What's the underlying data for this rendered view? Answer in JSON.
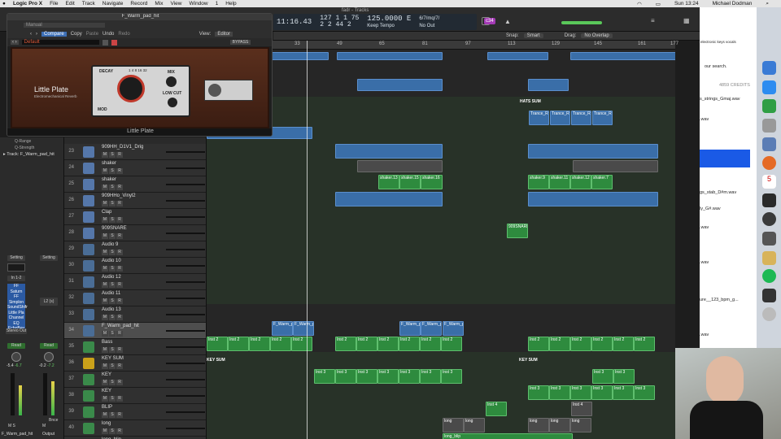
{
  "menubar": {
    "app": "Logic Pro X",
    "items": [
      "File",
      "Edit",
      "Track",
      "Navigate",
      "Record",
      "Mix",
      "View",
      "Window",
      "1",
      "Help"
    ],
    "clock": "Sun 13:24",
    "user": "Michael Dodman"
  },
  "window_title": "fadr - Tracks",
  "lcd": {
    "time": "11:16.43",
    "bars_top": "127",
    "beats_top": "1",
    "div_top": "1",
    "ticks_top": "75",
    "bars": "2",
    "beats": "2",
    "div": "44",
    "ticks": "2",
    "tempo": "125.0000",
    "key": "E",
    "tempo_mode": "Keep Tempo",
    "signature": "6/7/mq/7/",
    "midi": "No Out",
    "badge": "c34"
  },
  "controlbar": {
    "snap_label": "Snap:",
    "snap": "Smart",
    "drag_label": "Drag:",
    "drag": "No Overlap"
  },
  "ruler": [
    "33",
    "49",
    "65",
    "81",
    "97",
    "113",
    "129",
    "145",
    "161",
    "177"
  ],
  "plugin": {
    "title": "F_Warm_pad_hit",
    "preset_mode": "Manual",
    "compare": "Compare",
    "copy": "Copy",
    "paste": "Paste",
    "undo": "Undo",
    "redo": "Redo",
    "view_label": "View:",
    "view_value": "Editor",
    "preset": "Default",
    "bypass": "BYPASS",
    "name": "Little Plate",
    "subtitle": "Electromechanical Reverb",
    "decay": "DECAY",
    "mix": "MIX",
    "low_cut": "LOW CUT",
    "mod": "MOD",
    "footer": "Little Plate",
    "scale": [
      "1",
      "4",
      "8",
      "16",
      "32",
      "64"
    ]
  },
  "inspector": {
    "q_range": "Q-Range",
    "q_strength": "Q-Strength",
    "track_label": "Track:",
    "track_name": "F_Warm_pad_hit",
    "setting": "Setting",
    "input": "In 1-2",
    "plugins": [
      "FF Saturn",
      "FF Simplon",
      "SoundShifr",
      "Little Pla",
      "Channel EQ",
      "EchoBoy"
    ],
    "output": "Stereo Out",
    "read": "Read",
    "bus": "L2 (s)",
    "ch_name": "F_Warm_pad_hit",
    "out_name": "Output",
    "bnce": "Bnce",
    "db_left": "-5.4",
    "db_left2": "-6.7",
    "db_right": "-0.2",
    "db_right2": "-7.2"
  },
  "tracks": [
    {
      "n": "23",
      "name": "909HH_D1V1_Drig"
    },
    {
      "n": "24",
      "name": "shaker"
    },
    {
      "n": "25",
      "name": "shaker"
    },
    {
      "n": "26",
      "name": "909HHo_Vinyl2"
    },
    {
      "n": "27",
      "name": "Clap"
    },
    {
      "n": "28",
      "name": "909SNARE"
    },
    {
      "n": "29",
      "name": "Audio 9"
    },
    {
      "n": "30",
      "name": "Audio 10"
    },
    {
      "n": "31",
      "name": "Audio 12"
    },
    {
      "n": "32",
      "name": "Audio 11"
    },
    {
      "n": "33",
      "name": "Audio 13"
    },
    {
      "n": "34",
      "name": "F_Warm_pad_hit"
    },
    {
      "n": "35",
      "name": "Bass"
    },
    {
      "n": "36",
      "name": "KEY SUM"
    },
    {
      "n": "37",
      "name": "KEY"
    },
    {
      "n": "38",
      "name": "KEY"
    },
    {
      "n": "39",
      "name": "BLIP"
    },
    {
      "n": "40",
      "name": "long"
    },
    {
      "n": "41",
      "name": "long_blip"
    }
  ],
  "regions": {
    "hats_sum": "HATS SUM",
    "key_sum": "KEY SUM",
    "trance": "Trance_RID",
    "shaker13": "shaker.13",
    "shaker15": "shaker.15",
    "shaker16": "shaker.16",
    "shaker9": "shaker.9",
    "shaker11": "shaker.11",
    "shaker12": "shaker.12",
    "shaker7": "shaker.7",
    "snare": "909SNARE",
    "pad": "F_Warm_pa",
    "inst2": "Inst 2",
    "inst3": "Inst 3",
    "inst4": "Inst 4",
    "long": "long",
    "long_blip": "long_blip"
  },
  "browser": {
    "tabs": "electronic  keys  vocals",
    "search": "our search.",
    "credits": "4859 CREDITS",
    "files": [
      "s_strings_Gmaj.wav",
      ".wav",
      "gs_stab_D#m.wav",
      "ly_G#.wav",
      ".wav",
      ".wav",
      "ure__123_bpm_g...",
      ".wav"
    ]
  }
}
